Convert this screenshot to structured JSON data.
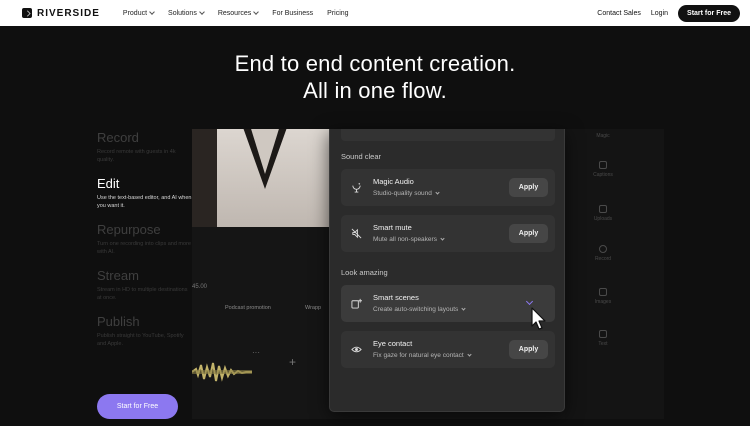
{
  "nav": {
    "brand": "RIVERSIDE",
    "links": [
      {
        "label": "Product",
        "dropdown": true
      },
      {
        "label": "Solutions",
        "dropdown": true
      },
      {
        "label": "Resources",
        "dropdown": true
      },
      {
        "label": "For Business",
        "dropdown": false
      },
      {
        "label": "Pricing",
        "dropdown": false
      }
    ],
    "contact_sales": "Contact Sales",
    "login": "Login",
    "cta": "Start for Free"
  },
  "hero": {
    "line1": "End to end content creation.",
    "line2": "All in one flow."
  },
  "steps": [
    {
      "title": "Record",
      "desc": "Record remote with guests in 4k quality.",
      "active": false
    },
    {
      "title": "Edit",
      "desc": "Use the text-based editor, and AI when you want it.",
      "active": true
    },
    {
      "title": "Repurpose",
      "desc": "Turn one recording into clips and more with AI.",
      "active": false
    },
    {
      "title": "Stream",
      "desc": "Stream in HD to multiple destinations at once.",
      "active": false
    },
    {
      "title": "Publish",
      "desc": "Publish straight to YouTube, Spotify and Apple.",
      "active": false
    }
  ],
  "start_button": "Start for Free",
  "editor": {
    "timestamp": "45.00",
    "chips": [
      "Podcast promotion",
      "Wrapp"
    ],
    "dots": "···",
    "plus": "+"
  },
  "sidebar_tools": [
    {
      "label": "Magic",
      "icon": "magic-icon"
    },
    {
      "label": "Captions",
      "icon": "captions-icon"
    },
    {
      "label": "Uploads",
      "icon": "upload-icon"
    },
    {
      "label": "Record",
      "icon": "record-icon"
    },
    {
      "label": "Images",
      "icon": "image-icon"
    },
    {
      "label": "Text",
      "icon": "text-icon"
    }
  ],
  "panel": {
    "sound_clear_label": "Sound clear",
    "look_amazing_label": "Look amazing",
    "cards": [
      {
        "title": "Magic Audio",
        "sub": "Studio-quality sound",
        "apply": "Apply",
        "icon": "magic-audio-icon"
      },
      {
        "title": "Smart mute",
        "sub": "Mute all non-speakers",
        "apply": "Apply",
        "icon": "smart-mute-icon"
      },
      {
        "title": "Smart scenes",
        "sub": "Create auto-switching layouts",
        "apply": "",
        "icon": "smart-scenes-icon"
      },
      {
        "title": "Eye contact",
        "sub": "Fix gaze for natural eye contact",
        "apply": "Apply",
        "icon": "eye-contact-icon"
      }
    ]
  },
  "colors": {
    "accent": "#8c78f0",
    "background": "#0f0f0f",
    "panel": "#2b2b2b",
    "card": "#333333"
  }
}
